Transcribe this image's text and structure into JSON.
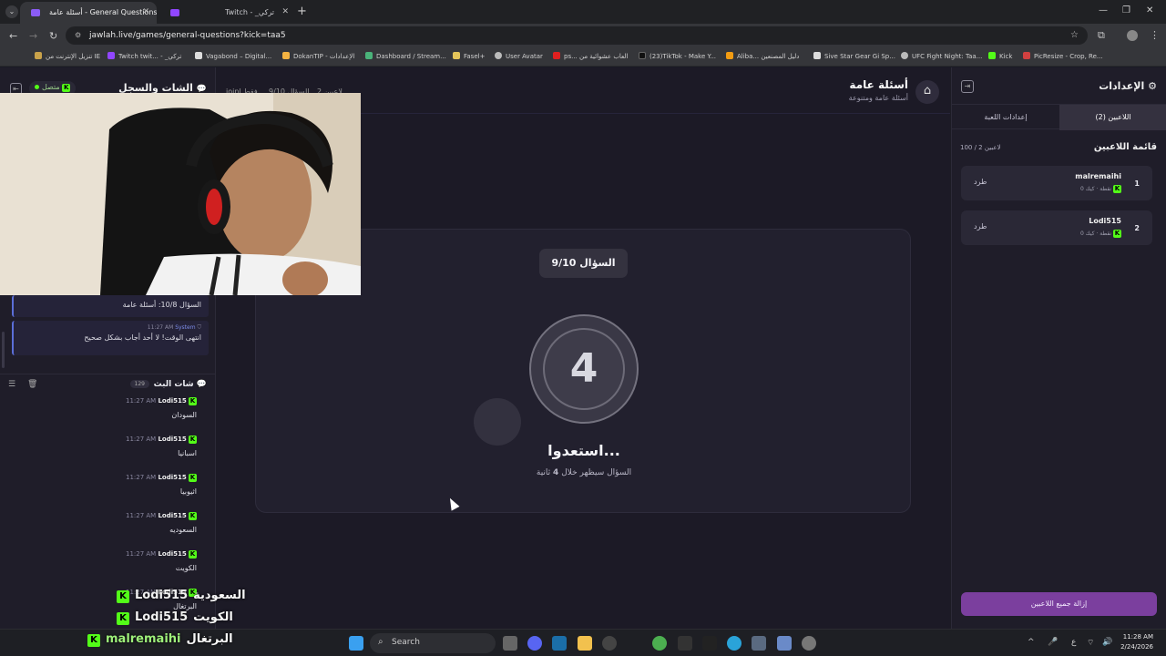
{
  "browser": {
    "tabs": [
      {
        "title": "أسئلة عامة - General Questions",
        "active": true
      },
      {
        "title": "Twitch - _تركي",
        "active": false
      }
    ],
    "url": "jawlah.live/games/general-questions?kick=taa5",
    "bookmarks": [
      "تنزيل الإنترنت من IE",
      "Twitch twit... - _تركي",
      "Vagabond – Digital...",
      "DokanTIP - الإعدادات",
      "Dashboard / Stream...",
      "Fasel+",
      "User Avatar",
      "ps... العاب عشوائية من",
      "(23)TikTok - Make Y...",
      "Aliba... دليل المصنعين",
      "Sive Star Gear Gi Sp...",
      "UFC Fight Night: Taa...",
      "Kick",
      "PicResize - Crop, Re..."
    ]
  },
  "left_panel": {
    "title": "الشات والسجل",
    "status": "متصل",
    "top_info": {
      "players": "2 لاعبين",
      "question": "السؤال 9/10",
      "mode": "joinl فقط"
    },
    "system_messages": [
      {
        "text": "السؤال 10/8: أسئلة عامة",
        "time": "",
        "sender": ""
      },
      {
        "text": "انتهى الوقت! لا أحد أجاب بشكل صحيح",
        "time": "11:27 AM",
        "sender": "System"
      }
    ],
    "stream_chat": {
      "title": "شات البث",
      "count": "129",
      "messages": [
        {
          "user": "Lodi515",
          "time": "11:27 AM",
          "text": "السودان"
        },
        {
          "user": "Lodi515",
          "time": "11:27 AM",
          "text": "اسبانيا"
        },
        {
          "user": "Lodi515",
          "time": "11:27 AM",
          "text": "اثيوبيا"
        },
        {
          "user": "Lodi515",
          "time": "11:27 AM",
          "text": "السعوديه"
        },
        {
          "user": "Lodi515",
          "time": "11:27 AM",
          "text": "الكويت"
        },
        {
          "user": "Lodi515",
          "time": "11:27 AM",
          "text": "البرتغال"
        }
      ]
    }
  },
  "center": {
    "game_title": "أسئلة عامة",
    "game_subtitle": "أسئلة عامة ومتنوعة",
    "question_pill": "السؤال 9/10",
    "countdown": "4",
    "ready_text": "استعدوا...",
    "ready_sub_prefix": "السؤال سيظهر خلال",
    "ready_sub_seconds": "4",
    "ready_sub_suffix": "ثانية"
  },
  "right_panel": {
    "title": "الإعدادات",
    "tabs": [
      "اللاعبين (2)",
      "إعدادات اللعبة"
    ],
    "player_list_title": "قائمة اللاعبين",
    "player_count": "100 / 2 لاعبين",
    "players": [
      {
        "rank": "1",
        "name": "malremaihi",
        "platform": "كيك",
        "points": "0 نقطة",
        "kick_label": "طرد"
      },
      {
        "rank": "2",
        "name": "Lodi515",
        "platform": "كيك",
        "points": "0 نقطة",
        "kick_label": "طرد"
      }
    ],
    "remove_all_label": "إزالة جميع اللاعبين"
  },
  "overlay_chat": [
    {
      "user": "Lodi515",
      "text": "السعودية"
    },
    {
      "user": "Lodi515",
      "text": "الكويت"
    },
    {
      "user": "malremaihi",
      "text": "البرتغال"
    }
  ],
  "taskbar": {
    "search_placeholder": "Search",
    "time": "11:28 AM",
    "date": "2/24/2026",
    "lang": "ع"
  },
  "colors": {
    "accent": "#7b3f9e",
    "kick_green": "#53fc18",
    "system_blue": "#5b6ed8"
  }
}
